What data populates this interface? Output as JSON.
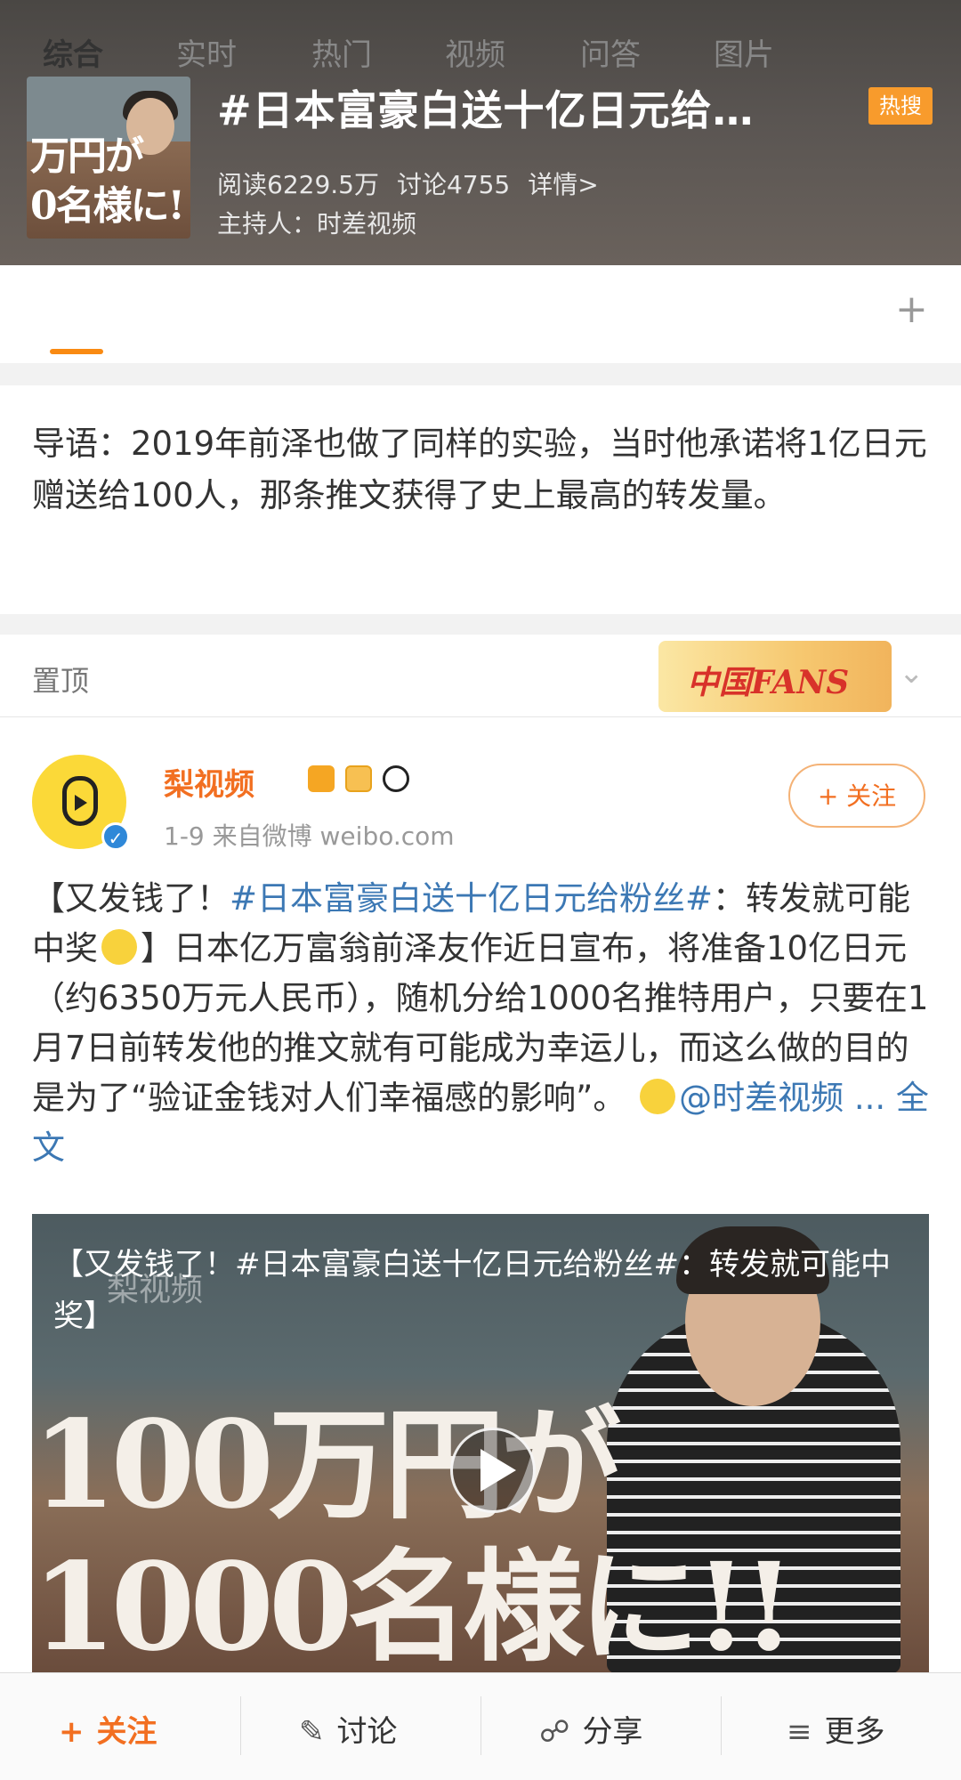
{
  "header": {
    "thumb_text": "万円が\n0名様に!",
    "title": "#日本富豪白送十亿日元给…",
    "hot_badge": "热搜",
    "reads": "阅读6229.5万",
    "discussions": "讨论4755",
    "details": "详情>",
    "host": "主持人：时差视频"
  },
  "tabs": [
    {
      "label": "综合"
    },
    {
      "label": "实时"
    },
    {
      "label": "热门"
    },
    {
      "label": "视频"
    },
    {
      "label": "问答"
    },
    {
      "label": "图片"
    }
  ],
  "tab_plus": "+",
  "guide": {
    "text": "导语：2019年前泽也做了同样的实验，当时他承诺将1亿日元赠送给100人，那条推文获得了史上最高的转发量。"
  },
  "pinned": {
    "label": "置顶",
    "badge_text": "中国FANS"
  },
  "post": {
    "author": "梨视频",
    "meta": "1-9  来自微博 weibo.com",
    "follow": "+ 关注",
    "text_part1": "【又发钱了！",
    "hashtag": "#日本富豪白送十亿日元给粉丝#",
    "text_part2": "：转发就可能中奖",
    "text_part3": "】日本亿万富翁前泽友作近日宣布，将准备10亿日元（约6350万元人民币），随机分给1000名推特用户，只要在1月7日前转发他的推文就有可能成为幸运儿，而这么做的目的是为了“验证金钱对人们幸福感的影响”。",
    "mention": "@时差视频",
    "fulltext": "... 全文"
  },
  "video": {
    "title": "【又发钱了！#日本富豪白送十亿日元给粉丝#：转发就可能中奖】",
    "watermark": "梨视频",
    "bigtext_line1": "100万円が",
    "bigtext_line2": "1000名様に!!"
  },
  "bottom_bar": {
    "follow": "关注",
    "discuss": "讨论",
    "share": "分享",
    "more": "更多"
  }
}
